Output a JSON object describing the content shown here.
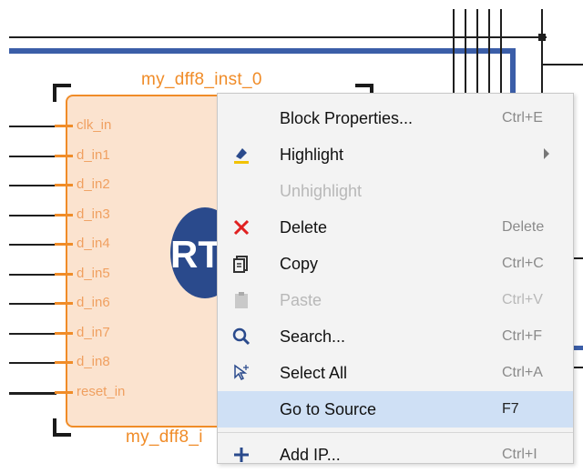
{
  "canvas": {
    "block": {
      "title_top": "my_dff8_inst_0",
      "title_bottom": "my_dff8_i",
      "logo_text": "RT",
      "pins": [
        "clk_in",
        "d_in1",
        "d_in2",
        "d_in3",
        "d_in4",
        "d_in5",
        "d_in6",
        "d_in7",
        "d_in8",
        "reset_in"
      ]
    }
  },
  "context_menu": {
    "items": [
      {
        "label": "Block Properties...",
        "shortcut": "Ctrl+E",
        "icon": "none",
        "enabled": true
      },
      {
        "label": "Highlight",
        "shortcut": "",
        "icon": "highlight-icon",
        "enabled": true,
        "submenu": true
      },
      {
        "label": "Unhighlight",
        "shortcut": "",
        "icon": "none",
        "enabled": false
      },
      {
        "label": "Delete",
        "shortcut": "Delete",
        "icon": "delete-x-icon",
        "enabled": true
      },
      {
        "label": "Copy",
        "shortcut": "Ctrl+C",
        "icon": "copy-icon",
        "enabled": true
      },
      {
        "label": "Paste",
        "shortcut": "Ctrl+V",
        "icon": "paste-icon",
        "enabled": false
      },
      {
        "label": "Search...",
        "shortcut": "Ctrl+F",
        "icon": "search-icon",
        "enabled": true
      },
      {
        "label": "Select All",
        "shortcut": "Ctrl+A",
        "icon": "select-all-icon",
        "enabled": true
      },
      {
        "label": "Go to Source",
        "shortcut": "F7",
        "icon": "none",
        "enabled": true,
        "selected": true
      },
      {
        "label": "Add IP...",
        "shortcut": "Ctrl+I",
        "icon": "add-icon",
        "enabled": true
      }
    ]
  },
  "colors": {
    "block_border": "#f08c28",
    "block_fill": "#fbe3cf",
    "bus": "#3b5ea8",
    "menu_bg": "#f3f3f3",
    "menu_selected": "#cfe0f5",
    "delete_red": "#e02020"
  }
}
